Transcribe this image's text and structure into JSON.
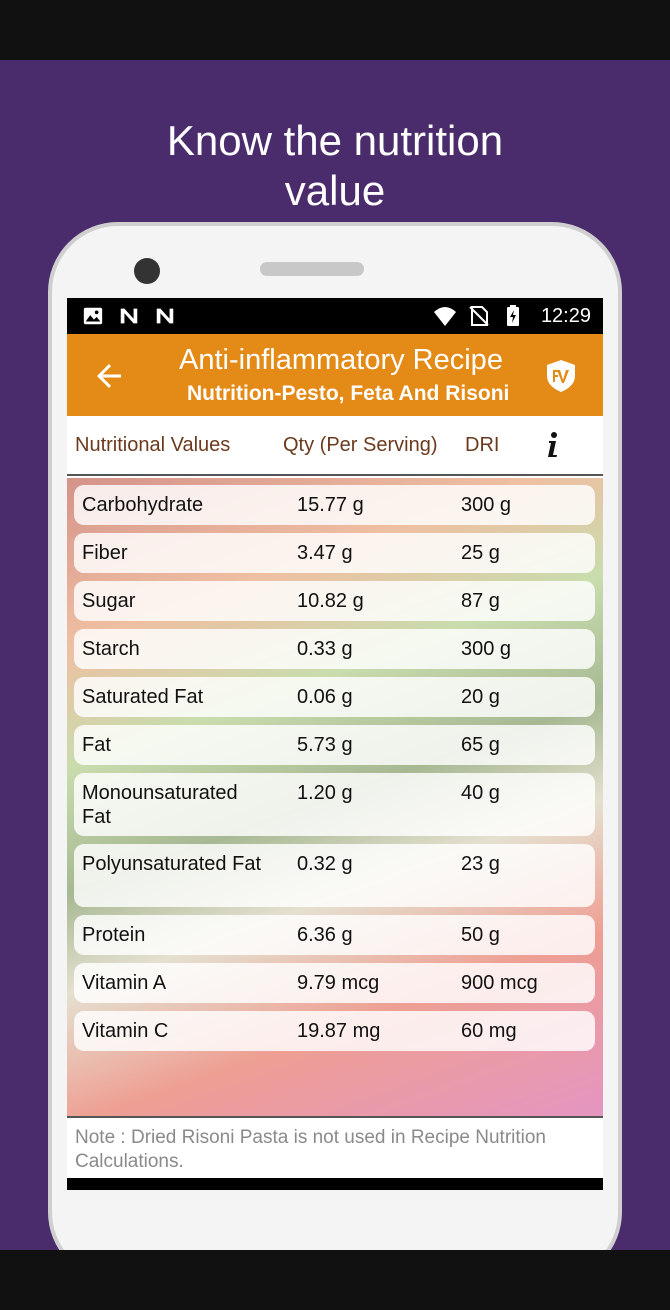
{
  "promo": {
    "headline_line1": "Know the nutrition",
    "headline_line2": "value",
    "background_color": "#4a2b6b"
  },
  "status_bar": {
    "left_icons": [
      "image-icon",
      "n-notification-icon",
      "n-notification-icon"
    ],
    "right_icons": [
      "wifi-icon",
      "no-sim-icon",
      "battery-charging-icon"
    ],
    "time": "12:29"
  },
  "app_bar": {
    "title": "Anti-inflammatory Recipe",
    "subtitle": "Nutrition-Pesto, Feta And Risoni",
    "color": "#e38a17",
    "back_icon": "arrow-back-icon",
    "logo_icon": "app-logo-icon"
  },
  "table": {
    "headers": {
      "name": "Nutritional Values",
      "qty": "Qty (Per Serving)",
      "dri": "DRI",
      "info_icon": "info-icon"
    },
    "rows": [
      {
        "name": "Carbohydrate",
        "qty": "15.77 g",
        "dri": "300 g"
      },
      {
        "name": "Fiber",
        "qty": "3.47 g",
        "dri": "25 g"
      },
      {
        "name": "Sugar",
        "qty": "10.82 g",
        "dri": "87 g"
      },
      {
        "name": "Starch",
        "qty": "0.33 g",
        "dri": "300 g"
      },
      {
        "name": "Saturated Fat",
        "qty": "0.06 g",
        "dri": "20 g"
      },
      {
        "name": "Fat",
        "qty": "5.73 g",
        "dri": "65 g"
      },
      {
        "name": "Monounsaturated Fat",
        "qty": "1.20 g",
        "dri": "40 g"
      },
      {
        "name": "Polyunsaturated Fat",
        "qty": "0.32 g",
        "dri": "23 g"
      },
      {
        "name": "Protein",
        "qty": "6.36 g",
        "dri": "50 g"
      },
      {
        "name": "Vitamin A",
        "qty": "9.79 mcg",
        "dri": "900 mcg"
      },
      {
        "name": "Vitamin C",
        "qty": "19.87 mg",
        "dri": "60 mg"
      }
    ]
  },
  "note": {
    "text": "Note : Dried Risoni Pasta  is not used in Recipe Nutrition Calculations."
  }
}
